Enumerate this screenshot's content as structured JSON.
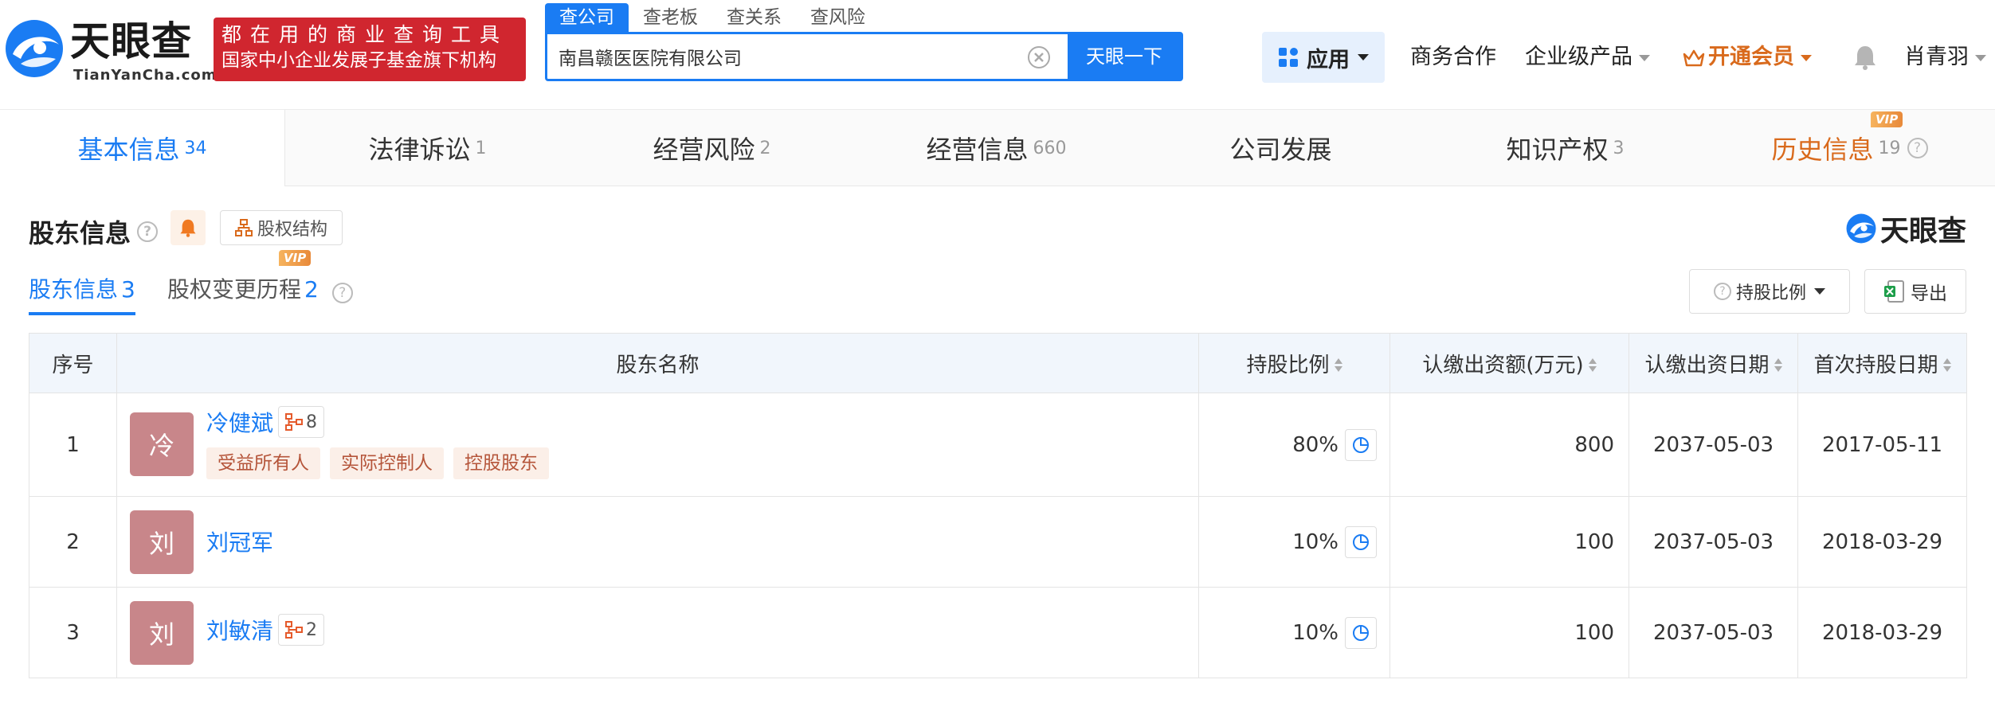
{
  "header": {
    "logo_text": "天眼查",
    "logo_sub": "TianYanCha.com",
    "promo_line1": "都在用的商业查询工具",
    "promo_line2": "国家中小企业发展子基金旗下机构",
    "search_tabs": [
      "查公司",
      "查老板",
      "查关系",
      "查风险"
    ],
    "search_value": "南昌赣医医院有限公司",
    "search_button": "天眼一下",
    "app_label": "应用",
    "nav": {
      "business": "商务合作",
      "enterprise": "企业级产品",
      "vip": "开通会员",
      "user": "肖青羽"
    }
  },
  "tabs": [
    {
      "label": "基本信息",
      "count": "34"
    },
    {
      "label": "法律诉讼",
      "count": "1"
    },
    {
      "label": "经营风险",
      "count": "2"
    },
    {
      "label": "经营信息",
      "count": "660"
    },
    {
      "label": "公司发展",
      "count": ""
    },
    {
      "label": "知识产权",
      "count": "3"
    },
    {
      "label": "历史信息",
      "count": "19"
    }
  ],
  "vip_badge": "VIP",
  "section": {
    "title": "股东信息",
    "equity_button": "股权结构",
    "brand": "天眼查",
    "subtabs": [
      {
        "label": "股东信息",
        "count": "3"
      },
      {
        "label": "股权变更历程",
        "count": "2"
      }
    ],
    "ratio_button": "持股比例",
    "export_button": "导出"
  },
  "table": {
    "headers": [
      "序号",
      "股东名称",
      "持股比例",
      "认缴出资额(万元)",
      "认缴出资日期",
      "首次持股日期"
    ],
    "rows": [
      {
        "index": "1",
        "avatar": "冷",
        "name": "冷健斌",
        "relations": "8",
        "tags": [
          "受益所有人",
          "实际控制人",
          "控股股东"
        ],
        "ratio": "80%",
        "amount": "800",
        "sub_date": "2037-05-03",
        "first_date": "2017-05-11"
      },
      {
        "index": "2",
        "avatar": "刘",
        "name": "刘冠军",
        "relations": "",
        "tags": [],
        "ratio": "10%",
        "amount": "100",
        "sub_date": "2037-05-03",
        "first_date": "2018-03-29"
      },
      {
        "index": "3",
        "avatar": "刘",
        "name": "刘敏清",
        "relations": "2",
        "tags": [],
        "ratio": "10%",
        "amount": "100",
        "sub_date": "2037-05-03",
        "first_date": "2018-03-29"
      }
    ]
  },
  "colors": {
    "accent": "#1a7cf3",
    "promo_red": "#d0262f",
    "vip_orange": "#d96a1c",
    "avatar": "#c8868a"
  }
}
